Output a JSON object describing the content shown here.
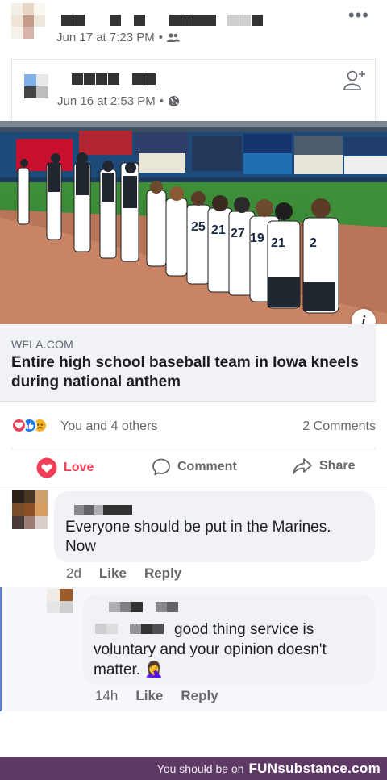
{
  "post": {
    "timestamp": "Jun 17 at 7:23 PM",
    "separator": "•",
    "audience_icon": "friends-icon",
    "more_icon": "more-dots-icon",
    "more_glyph": "•••"
  },
  "shared_post": {
    "timestamp": "Jun 16 at 2:53 PM",
    "separator": "•",
    "audience_icon": "globe-icon",
    "add_friend_icon": "add-friend-icon"
  },
  "photo": {
    "info_glyph": "i"
  },
  "link_preview": {
    "domain": "WFLA.COM",
    "title": "Entire high school baseball team in Iowa kneels during national anthem"
  },
  "reactions": {
    "summary": "You and 4 others",
    "comments": "2 Comments",
    "icons": [
      "love-reaction-icon",
      "like-reaction-icon",
      "sad-reaction-icon"
    ],
    "colors": {
      "love": "#f33e58",
      "like": "#1877f2",
      "sad": "#f7b125"
    }
  },
  "actions": {
    "love_label": "Love",
    "comment_label": "Comment",
    "share_label": "Share"
  },
  "comments": [
    {
      "text": "Everyone should be put in the Marines. Now",
      "time": "2d",
      "like_label": "Like",
      "reply_label": "Reply"
    },
    {
      "text": "good thing service is voluntary and your opinion doesn't matter. 🤦‍♀️",
      "time": "14h",
      "like_label": "Like",
      "reply_label": "Reply"
    }
  ],
  "footer": {
    "text": "You should be on",
    "brand": "FUNsubstance.com"
  }
}
